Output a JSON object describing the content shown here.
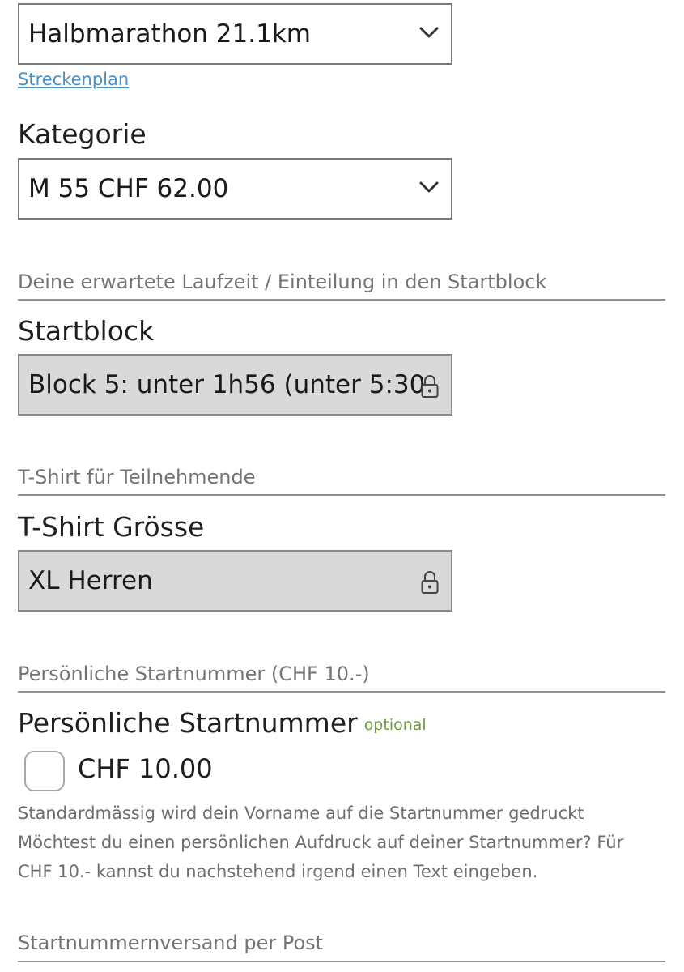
{
  "distance": {
    "selected": "Halbmarathon 21.1km",
    "route_link": "Streckenplan"
  },
  "category": {
    "label": "Kategorie",
    "selected": "M 55 CHF 62.00"
  },
  "runtime_section": {
    "title": "Deine erwartete Laufzeit / Einteilung in den Startblock",
    "field_label": "Startblock",
    "value": "Block 5: unter 1h56 (unter 5:30"
  },
  "tshirt_section": {
    "title": "T-Shirt für Teilnehmende",
    "field_label": "T-Shirt Grösse",
    "value": "XL Herren"
  },
  "bib_section": {
    "title": "Persönliche Startnummer (CHF 10.-)",
    "field_label": "Persönliche Startnummer",
    "optional": "optional",
    "checkbox_label": "CHF 10.00",
    "checked": false,
    "help_lines": [
      "Standardmässig wird dein Vorname auf die Startnummer gedruckt",
      "Möchtest du einen persönlichen Aufdruck auf deiner Startnummer? Für",
      "CHF 10.- kannst du nachstehend irgend einen Text eingeben."
    ]
  },
  "shipping_section": {
    "title": "Startnummernversand per Post"
  },
  "icons": {
    "dropdown": "chevron-down-icon",
    "locked": "lock-icon"
  },
  "colors": {
    "link": "#4a90c8",
    "optional": "#6d9a3a",
    "locked_field_bg": "#d9d9d9",
    "section_title": "#747474"
  }
}
